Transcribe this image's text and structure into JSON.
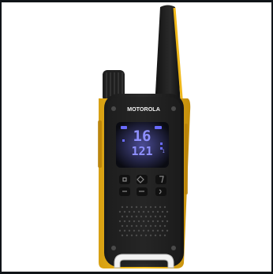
{
  "product": {
    "brand_label": "MOTOROLA",
    "display_main": "16",
    "display_sub": "121",
    "display_small": "1",
    "colors": {
      "body": "#232323",
      "body_dark": "#141414",
      "accent_yellow": "#f0b81a",
      "display_bg": "#0a0b12",
      "display_glow": "#6a6bff",
      "panel_text": "#f2f2f2"
    }
  }
}
